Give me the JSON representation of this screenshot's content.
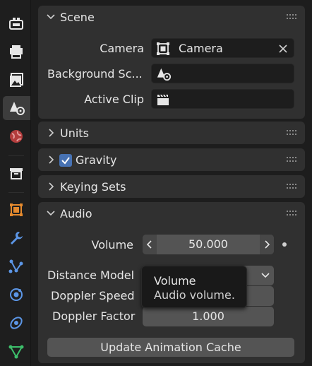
{
  "sidebar": {
    "tabs": [
      {
        "icon": "tool-icon"
      },
      {
        "icon": "render-icon"
      },
      {
        "icon": "output-icon"
      },
      {
        "icon": "view-layer-icon"
      },
      {
        "icon": "scene-icon"
      },
      {
        "icon": "world-icon"
      },
      {
        "icon": "collection-icon"
      },
      {
        "icon": "object-icon"
      },
      {
        "icon": "modifier-icon"
      },
      {
        "icon": "particles-icon"
      },
      {
        "icon": "physics-icon"
      },
      {
        "icon": "constraints-icon"
      },
      {
        "icon": "data-icon"
      }
    ],
    "active_tab": "scene-icon"
  },
  "scene_panel": {
    "title": "Scene",
    "camera_label": "Camera",
    "camera_value": "Camera",
    "background_label": "Background Sc...",
    "background_value": "",
    "active_clip_label": "Active Clip",
    "active_clip_value": ""
  },
  "units_panel": {
    "title": "Units"
  },
  "gravity_panel": {
    "title": "Gravity",
    "checked": true
  },
  "keying_sets_panel": {
    "title": "Keying Sets"
  },
  "audio_panel": {
    "title": "Audio",
    "volume_label": "Volume",
    "volume_value": "50.000",
    "distance_model_label": "Distance Model",
    "doppler_speed_label": "Doppler Speed",
    "doppler_factor_label": "Doppler Factor",
    "doppler_factor_value": "1.000",
    "update_cache_label": "Update Animation Cache"
  },
  "tooltip": {
    "title": "Volume",
    "description": "Audio volume."
  },
  "colors": {
    "accent": "#4772b3",
    "panel_bg": "#303030",
    "field_bg": "#1d1d1d",
    "button_bg": "#545454"
  }
}
